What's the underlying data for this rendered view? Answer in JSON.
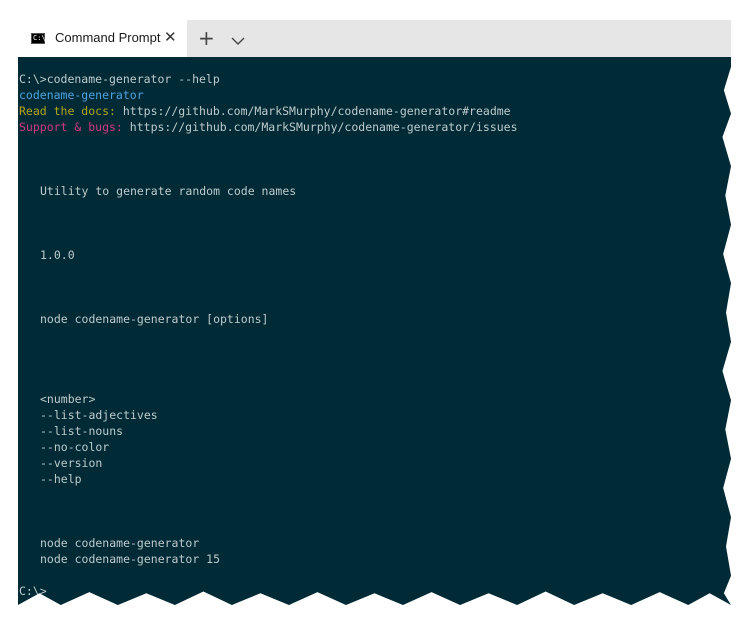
{
  "tab": {
    "icon_text": "C:\\",
    "title": "Command Prompt",
    "close": "✕",
    "new_tab": "+"
  },
  "colors": {
    "terminal_bg": "#002b36",
    "text": "#c0c9cc",
    "app_name": "#4aa3df",
    "docs": "#b5a417",
    "support": "#d33682"
  },
  "terminal": {
    "command": "C:\\>codename-generator --help",
    "app_name": "codename-generator",
    "docs_label": "Read the docs:",
    "docs_url": "https://github.com/MarkSMurphy/codename-generator#readme",
    "support_label": "Support & bugs:",
    "support_url": "https://github.com/MarkSMurphy/codename-generator/issues",
    "description": "Utility to generate random code names",
    "version": "1.0.0",
    "usage": "node codename-generator [options]",
    "options": [
      "<number>",
      "--list-adjectives",
      "--list-nouns",
      "--no-color",
      "--version",
      "--help"
    ],
    "examples": [
      "node codename-generator",
      "node codename-generator 15"
    ],
    "prompt": "C:\\>"
  }
}
